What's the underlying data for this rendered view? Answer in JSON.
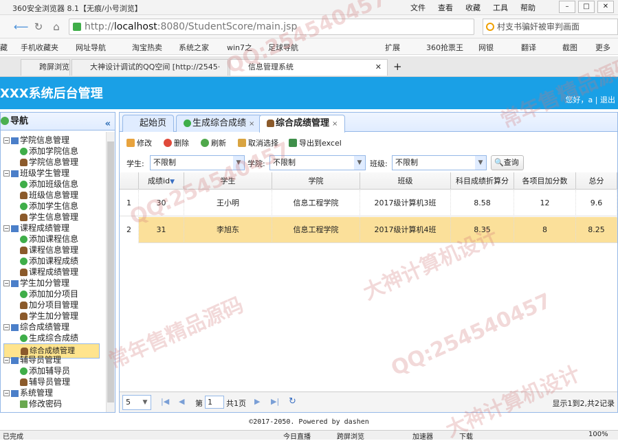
{
  "browser": {
    "title": "360安全浏览器 8.1【无痕/小号浏览】",
    "menu": [
      "文件",
      "查看",
      "收藏",
      "工具",
      "帮助"
    ],
    "url_prefix": "http://",
    "url_host": "localhost",
    "url_rest": ":8080/StudentScore/main.jsp",
    "search_text": "村支书骗奸被审判画面",
    "bookmarks": [
      "藏",
      "手机收藏夹",
      "网址导航",
      "淘宝热卖",
      "系统之家",
      "win7之",
      "足球导航",
      "扩展",
      "360抢票王",
      "网银",
      "翻译",
      "截图",
      "更多"
    ],
    "tabs": [
      "跨屏浏览",
      "大神设计调试的QQ空间 [http://2545·",
      "信息管理系统"
    ]
  },
  "app": {
    "title": "XXX系统后台管理",
    "user_text": "您好，a | 退出"
  },
  "nav": {
    "title": "导航",
    "groups": [
      {
        "label": "学院信息管理",
        "items": [
          {
            "label": "添加学院信息",
            "type": "add"
          },
          {
            "label": "学院信息管理",
            "type": "user"
          }
        ]
      },
      {
        "label": "班级学生管理",
        "items": [
          {
            "label": "添加班级信息",
            "type": "add"
          },
          {
            "label": "班级信息管理",
            "type": "user"
          },
          {
            "label": "添加学生信息",
            "type": "add"
          },
          {
            "label": "学生信息管理",
            "type": "user"
          }
        ]
      },
      {
        "label": "课程成绩管理",
        "items": [
          {
            "label": "添加课程信息",
            "type": "add"
          },
          {
            "label": "课程信息管理",
            "type": "user"
          },
          {
            "label": "添加课程成绩",
            "type": "add"
          },
          {
            "label": "课程成绩管理",
            "type": "user"
          }
        ]
      },
      {
        "label": "学生加分管理",
        "items": [
          {
            "label": "添加加分项目",
            "type": "add"
          },
          {
            "label": "加分项目管理",
            "type": "user"
          },
          {
            "label": "学生加分管理",
            "type": "user"
          }
        ]
      },
      {
        "label": "综合成绩管理",
        "items": [
          {
            "label": "生成综合成绩",
            "type": "add"
          },
          {
            "label": "综合成绩管理",
            "type": "user",
            "selected": true
          }
        ]
      },
      {
        "label": "辅导员管理",
        "items": [
          {
            "label": "添加辅导员",
            "type": "add"
          },
          {
            "label": "辅导员管理",
            "type": "user"
          }
        ]
      },
      {
        "label": "系统管理",
        "items": [
          {
            "label": "修改密码",
            "type": "edit"
          }
        ]
      }
    ]
  },
  "tabs": [
    {
      "label": "起始页"
    },
    {
      "label": "生成综合成绩",
      "close": "×"
    },
    {
      "label": "综合成绩管理",
      "close": "×",
      "active": true
    }
  ],
  "toolbar": {
    "edit": "修改",
    "delete": "删除",
    "refresh": "刷新",
    "cancel": "取消选择",
    "export": "导出到excel"
  },
  "filters": {
    "student_label": "学生:",
    "student_value": "不限制",
    "college_label": "学院:",
    "college_value": "不限制",
    "class_label": "班级:",
    "class_value": "不限制",
    "query": "查询"
  },
  "grid": {
    "columns": [
      "成绩id",
      "学生",
      "学院",
      "班级",
      "科目成绩折算分",
      "各项目加分数",
      "总分"
    ],
    "rows": [
      {
        "num": "1",
        "cells": [
          "30",
          "王小明",
          "信息工程学院",
          "2017级计算机3班",
          "8.58",
          "12",
          "9.6"
        ]
      },
      {
        "num": "2",
        "cells": [
          "31",
          "李旭东",
          "信息工程学院",
          "2017级计算机4班",
          "8.35",
          "8",
          "8.25"
        ]
      }
    ]
  },
  "pager": {
    "page_size": "5",
    "page_label": "第",
    "page_value": "1",
    "page_total": "共1页",
    "summary": "显示1到2,共2记录"
  },
  "footer": "©2017-2050. Powered by dashen",
  "status": {
    "left": "已完成",
    "items": [
      "今日直播",
      "跨屏浏览",
      "加速器",
      "下载",
      "100%"
    ]
  },
  "watermarks": [
    "QQ:254540457",
    "常年售精品源码",
    "大神计算机设计"
  ],
  "colors": {
    "banner": "#1aa0e6",
    "selected_row": "#fbe09a",
    "panel_border": "#95b8e7"
  }
}
